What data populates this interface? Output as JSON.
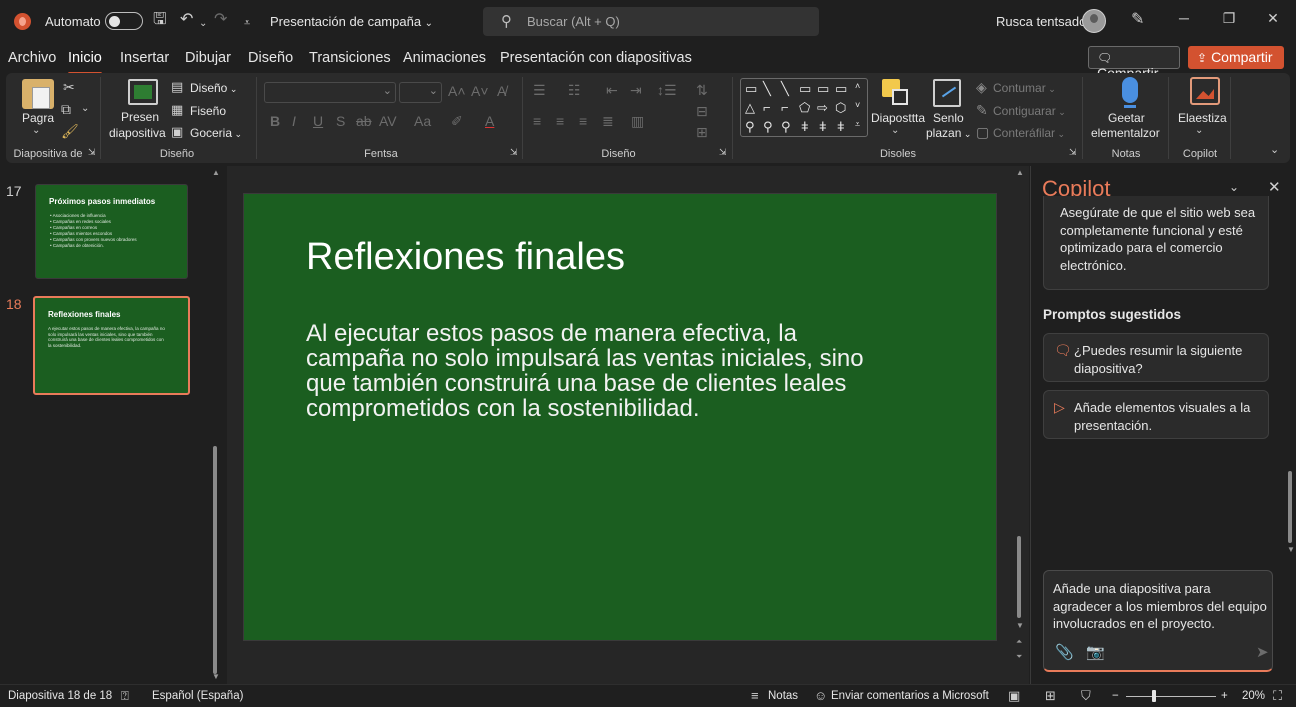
{
  "titlebar": {
    "autosave_label": "Automato",
    "document_title": "Presentación de campaña",
    "search_placeholder": "Buscar (Alt + Q)",
    "user_name": "Rusca tentsado"
  },
  "menu": {
    "tabs": [
      "Archivo",
      "Inicio",
      "Insertar",
      "Dibujar",
      "Diseño",
      "Transiciones",
      "Animaciones",
      "Presentación con diapositivas"
    ],
    "active_tab": "Inicio",
    "share_label": "Compartir",
    "share_primary_label": "Compartir"
  },
  "ribbon": {
    "clipboard": {
      "paste_label": "Pagra",
      "group_label": "Diapositiva de"
    },
    "slides": {
      "new_slide_line1": "Presen",
      "new_slide_line2": "diapositiva",
      "layout_label": "Diseño",
      "reset_label": "Fiseño",
      "section_label": "Goceria",
      "group_label": "Diseño"
    },
    "font": {
      "group_label": "Fentsa"
    },
    "paragraph": {
      "group_label": "Diseño"
    },
    "drawing": {
      "arrange_label": "Diaposttta",
      "quick_styles_line1": "Senlo",
      "quick_styles_line2": "plazan",
      "fill_label": "Contumar",
      "outline_label": "Contiguarar",
      "effects_label": "Conteráfilar",
      "group_label": "Disoles"
    },
    "voice": {
      "label_line1": "Geetar",
      "label_line2": "elementalzor",
      "group_label": "Notas"
    },
    "designer": {
      "label": "Elaestiza",
      "group_label": "Copilot"
    }
  },
  "thumbnails": [
    {
      "number": "17",
      "title": "Próximos pasos inmediatos",
      "bullets": [
        "Asociaciones de influencia",
        "Campañas en redes sociales",
        "Campañas en correos",
        "Campañas mientos escondos",
        "Campañas con provers nuevos obradores",
        "Campañas de obtenición."
      ]
    },
    {
      "number": "18",
      "title": "Reflexiones finales",
      "body": "A ejecutar estos pasos de manera efectiva, la campaña no solo impulsará las ventas iniciales, sino que también construirá una base de clientes leales comprometidos con la sostenibilidad."
    }
  ],
  "slide": {
    "title": "Reflexiones finales",
    "body": "Al ejecutar estos pasos de manera efectiva, la campaña no solo impulsará las ventas iniciales, sino que también construirá una base de clientes leales comprometidos con la sostenibilidad."
  },
  "copilot": {
    "title": "Copilot",
    "message": "Asegúrate de que el sitio web sea completamente funcional y esté optimizado para el comercio electrónico.",
    "suggested_heading": "Promptos sugestidos",
    "prompts": [
      "¿Puedes resumir la siguiente diapositiva?",
      "Añade elementos visuales a la presentación."
    ],
    "input_text": "Añade una diapositiva para agradecer a los miembros del equipo involucrados en el proyecto."
  },
  "statusbar": {
    "slide_position": "Diapositiva 18 de 18",
    "language": "Español (España)",
    "notes_label": "Notas",
    "feedback_label": "Enviar comentarios a Microsoft",
    "zoom_level": "20%"
  },
  "colors": {
    "accent": "#d35230",
    "slide_bg": "#1b5e20",
    "copilot_title": "#e97b5a"
  }
}
